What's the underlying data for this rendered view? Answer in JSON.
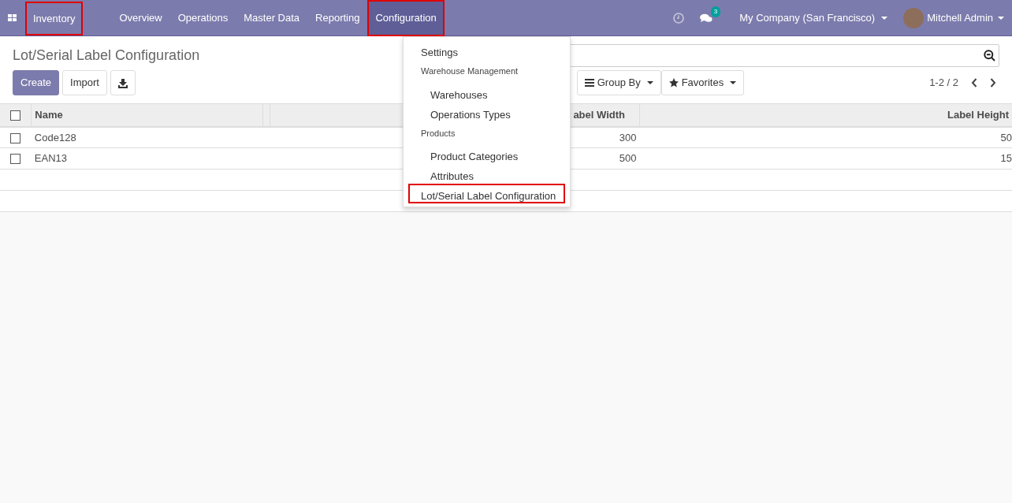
{
  "navbar": {
    "app_name": "Inventory",
    "app_name_highlighted": true,
    "menus": [
      {
        "label": "Overview",
        "selected": false,
        "highlighted": false
      },
      {
        "label": "Operations",
        "selected": false,
        "highlighted": false
      },
      {
        "label": "Master Data",
        "selected": false,
        "highlighted": false
      },
      {
        "label": "Reporting",
        "selected": false,
        "highlighted": false
      },
      {
        "label": "Configuration",
        "selected": true,
        "highlighted": true
      }
    ],
    "messages_badge": "3",
    "company": "My Company (San Francisco)",
    "user": "Mitchell Admin"
  },
  "dropdown": [
    {
      "kind": "item",
      "label": "Settings",
      "highlighted": false
    },
    {
      "kind": "header",
      "label": "Warehouse Management",
      "highlighted": false
    },
    {
      "kind": "subitem",
      "label": "Warehouses",
      "highlighted": false
    },
    {
      "kind": "subitem",
      "label": "Operations Types",
      "highlighted": false
    },
    {
      "kind": "header",
      "label": "Products",
      "highlighted": false
    },
    {
      "kind": "subitem",
      "label": "Product Categories",
      "highlighted": false
    },
    {
      "kind": "subitem",
      "label": "Attributes",
      "highlighted": false
    },
    {
      "kind": "item",
      "label": "Lot/Serial Label Configuration",
      "highlighted": true
    }
  ],
  "page_title": "Lot/Serial Label Configuration",
  "buttons": [
    "Create",
    "Import"
  ],
  "filters": [
    "Group By",
    "Favorites"
  ],
  "pager": "1-2 / 2",
  "table": {
    "all_checked": false,
    "columns": [
      "Name",
      "",
      "abel Width",
      "Label Height"
    ],
    "rows": [
      {
        "checked": false,
        "cells": [
          "Code128",
          "",
          "300",
          "50"
        ]
      },
      {
        "checked": false,
        "cells": [
          "EAN13",
          "",
          "500",
          "15"
        ]
      }
    ]
  }
}
